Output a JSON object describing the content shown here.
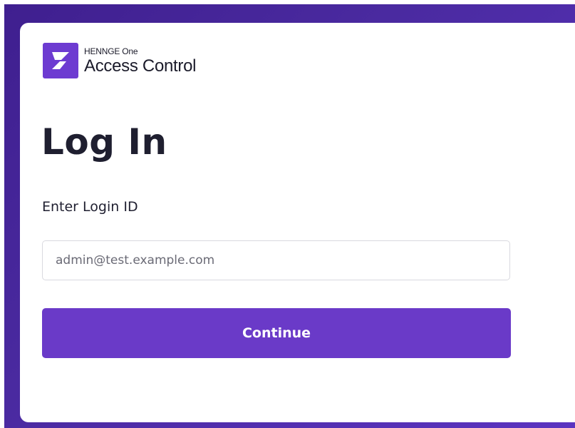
{
  "brand": {
    "company": "HENNGE One",
    "product": "Access Control",
    "icon": "henngeone-logo-icon"
  },
  "login": {
    "title": "Log In",
    "id_label": "Enter Login ID",
    "id_placeholder": "admin@test.example.com",
    "id_value": "",
    "continue_label": "Continue"
  },
  "colors": {
    "background": "#4a2aa0",
    "accent": "#6a3ac8",
    "text": "#1f1f30"
  }
}
